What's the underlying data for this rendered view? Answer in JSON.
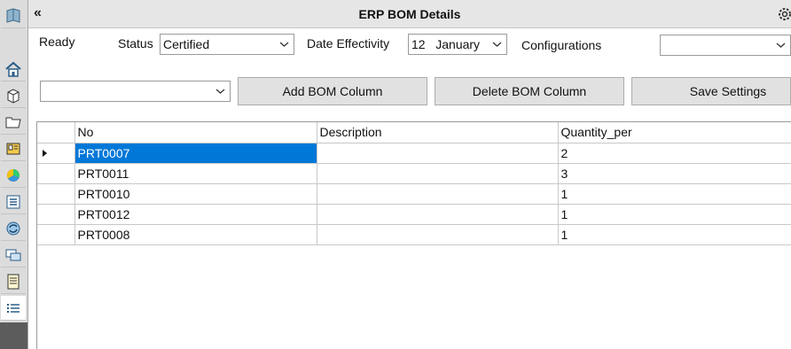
{
  "header": {
    "title": "ERP BOM Details",
    "collapse_glyph": "«"
  },
  "sidebar": {
    "icons": [
      "book-icon",
      "home-icon",
      "package-icon",
      "folder-icon",
      "id-card-icon",
      "color-wheel-icon",
      "list-icon",
      "sync-icon",
      "chat-icon",
      "notes-icon",
      "bullet-list-icon"
    ]
  },
  "filters": {
    "ready_label": "Ready",
    "status_label": "Status",
    "status_value": "Certified",
    "date_label": "Date Effectivity",
    "date_day": "12",
    "date_month": "January",
    "configurations_label": "Configurations",
    "configurations_value": "",
    "column_select_value": ""
  },
  "toolbar": {
    "add_label": "Add BOM Column",
    "delete_label": "Delete BOM Column",
    "save_label": "Save Settings"
  },
  "grid": {
    "columns": [
      "No",
      "Description",
      "Quantity_per"
    ],
    "rows": [
      {
        "no": "PRT0007",
        "description": "",
        "qty": "2"
      },
      {
        "no": "PRT0011",
        "description": "",
        "qty": "3"
      },
      {
        "no": "PRT0010",
        "description": "",
        "qty": "1"
      },
      {
        "no": "PRT0012",
        "description": "",
        "qty": "1"
      },
      {
        "no": "PRT0008",
        "description": "",
        "qty": "1"
      }
    ],
    "selected_row": 0
  }
}
